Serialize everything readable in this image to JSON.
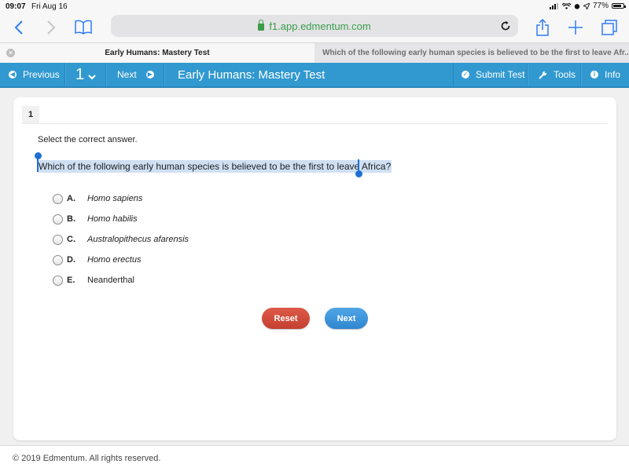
{
  "status_bar": {
    "time": "09:07",
    "date": "Fri Aug 16",
    "battery": "77%"
  },
  "browser": {
    "url": "f1.app.edmentum.com",
    "tabs": [
      {
        "label": "Early Humans: Mastery Test",
        "active": true
      },
      {
        "label": "Which of the following early human species is believed to be the first to leave Afr...",
        "active": false
      }
    ]
  },
  "navbar": {
    "previous_label": "Previous",
    "question_number": "1",
    "next_label": "Next",
    "title": "Early Humans: Mastery Test",
    "submit_label": "Submit Test",
    "tools_label": "Tools",
    "info_label": "Info",
    "color": "#3199d0"
  },
  "question": {
    "number": "1",
    "instruction": "Select the correct answer.",
    "text": "Which of the following early human species is believed to be the first to leave Africa?",
    "options": [
      {
        "letter": "A.",
        "text": "Homo sapiens",
        "italic": true
      },
      {
        "letter": "B.",
        "text": "Homo habilis",
        "italic": true
      },
      {
        "letter": "C.",
        "text": "Australopithecus afarensis",
        "italic": true
      },
      {
        "letter": "D.",
        "text": "Homo erectus",
        "italic": true
      },
      {
        "letter": "E.",
        "text": "Neanderthal",
        "italic": false
      }
    ]
  },
  "buttons": {
    "reset_label": "Reset",
    "next_label": "Next",
    "reset_color": "#d04d3b",
    "next_color": "#3d95dc"
  },
  "footer": {
    "copyright": "© 2019 Edmentum. All rights reserved."
  }
}
